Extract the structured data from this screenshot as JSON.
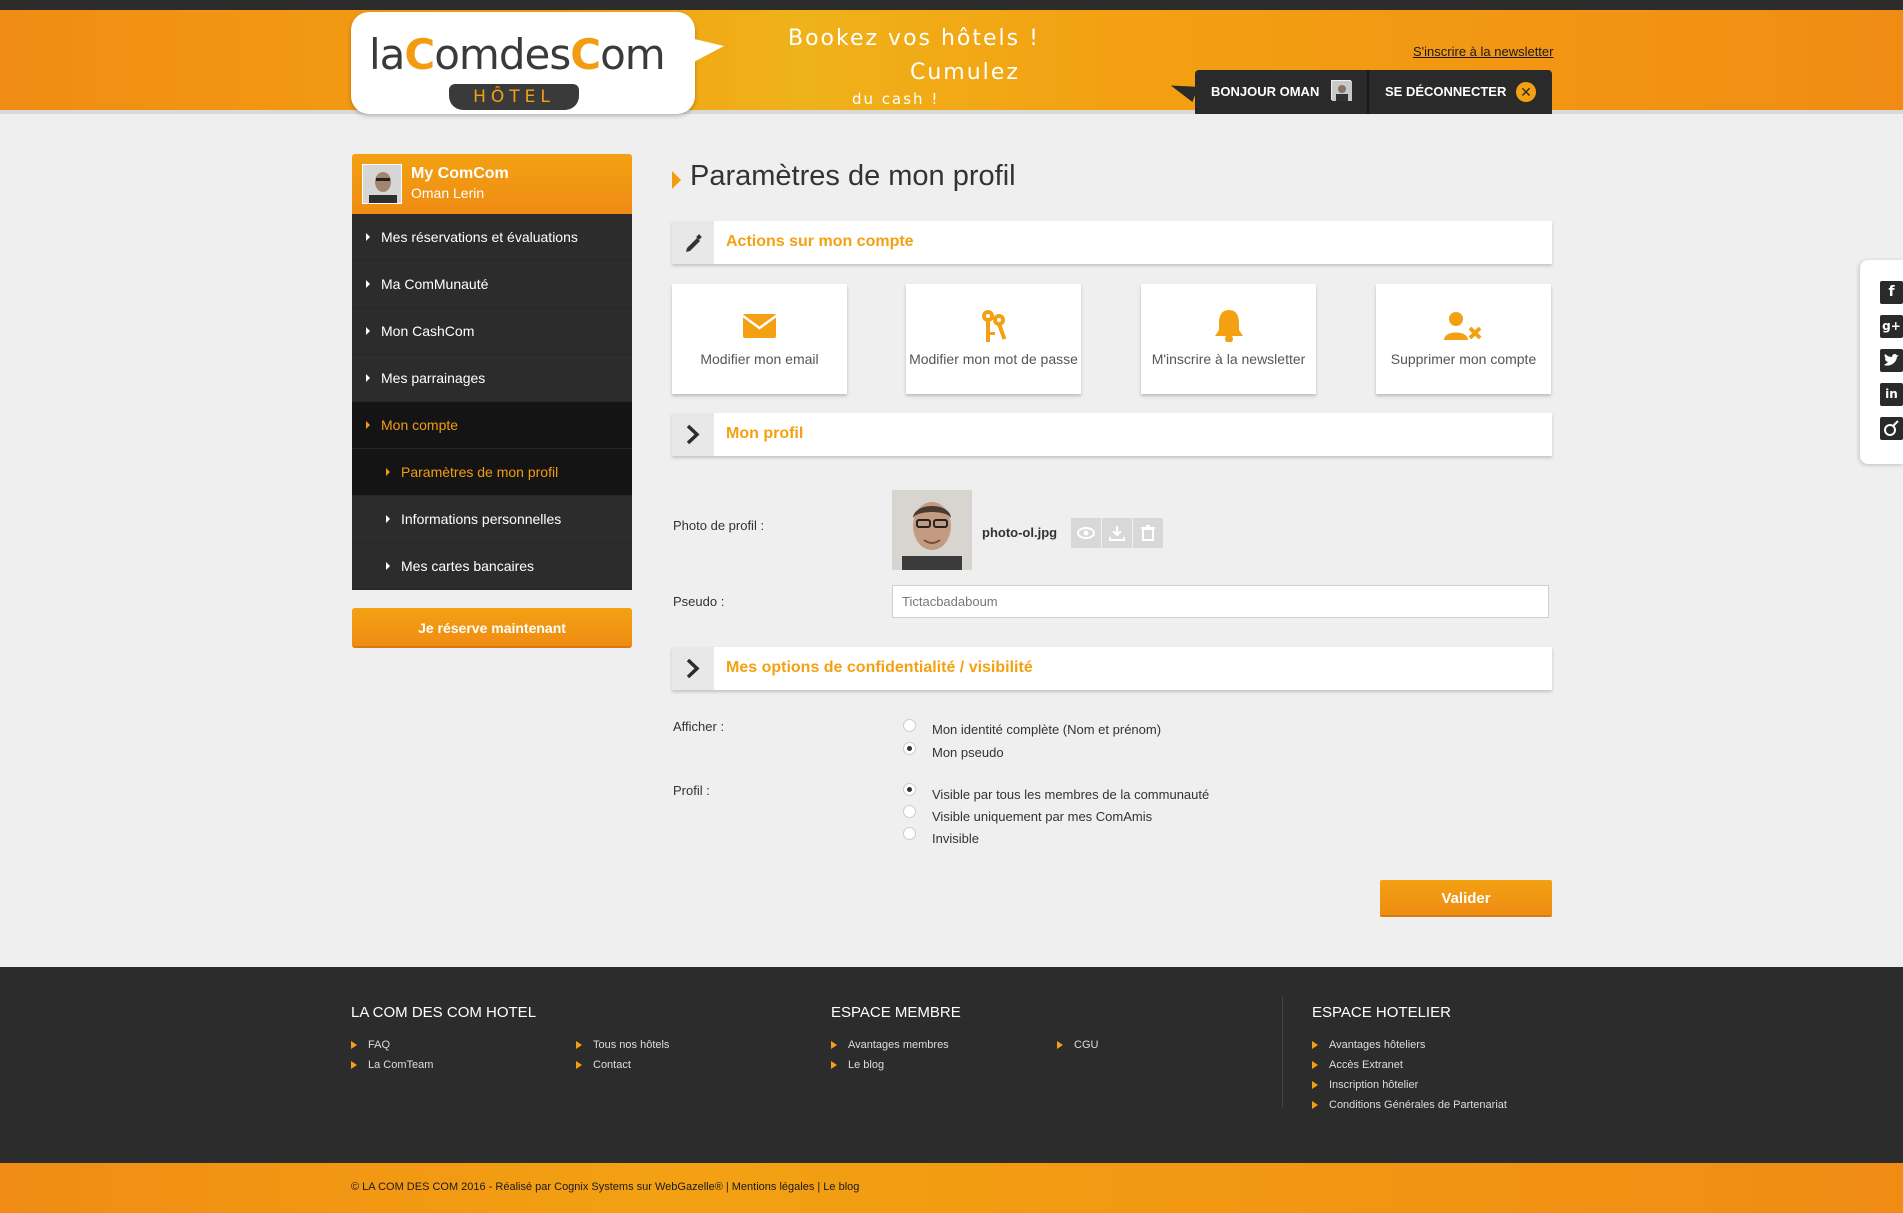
{
  "header": {
    "logo_text_1": "la",
    "logo_text_2": "C",
    "logo_text_3": "omdes",
    "logo_text_4": "C",
    "logo_text_5": "om",
    "logo_sub": "HÔTEL",
    "slogan_l1": "Bookez vos hôtels !",
    "slogan_l2": "Cumulez",
    "slogan_l3": "du cash !",
    "newsletter_link": "S'inscrire à la newsletter",
    "greeting": "BONJOUR OMAN",
    "logout": "SE DÉCONNECTER"
  },
  "sidebar": {
    "title": "My ComCom",
    "user_name": "Oman Lerin",
    "items": [
      {
        "label": "Mes réservations et évaluations"
      },
      {
        "label": "Ma ComMunauté"
      },
      {
        "label": "Mon CashCom"
      },
      {
        "label": "Mes parrainages"
      },
      {
        "label": "Mon compte"
      },
      {
        "label": "Paramètres de mon profil"
      },
      {
        "label": "Informations personnelles"
      },
      {
        "label": "Mes cartes bancaires"
      }
    ],
    "reserve_button": "Je réserve maintenant"
  },
  "main": {
    "page_title": "Paramètres de mon profil",
    "section_actions": "Actions sur mon compte",
    "actions": [
      {
        "label": "Modifier mon email",
        "icon": "envelope-icon"
      },
      {
        "label": "Modifier mon mot de passe",
        "icon": "keys-icon"
      },
      {
        "label": "M'inscrire à la newsletter",
        "icon": "bell-icon"
      },
      {
        "label": "Supprimer mon compte",
        "icon": "user-delete-icon"
      }
    ],
    "section_profile": "Mon profil",
    "photo_label": "Photo de profil :",
    "photo_filename": "photo-ol.jpg",
    "pseudo_label": "Pseudo :",
    "pseudo_value": "Tictacbadaboum",
    "section_privacy": "Mes options de confidentialité / visibilité",
    "afficher_label": "Afficher :",
    "afficher_options": [
      {
        "label": "Mon identité complète (Nom et prénom)",
        "selected": false
      },
      {
        "label": "Mon pseudo",
        "selected": true
      }
    ],
    "profil_label": "Profil :",
    "profil_options": [
      {
        "label": "Visible par tous les membres de la communauté",
        "selected": true
      },
      {
        "label": "Visible uniquement par mes ComAmis",
        "selected": false
      },
      {
        "label": "Invisible",
        "selected": false
      }
    ],
    "submit": "Valider"
  },
  "footer": {
    "col1_title": "LA COM DES COM HOTEL",
    "col1_links": [
      "FAQ",
      "La ComTeam",
      "Tous nos hôtels",
      "Contact"
    ],
    "col2_title": "ESPACE MEMBRE",
    "col2_links": [
      "Avantages membres",
      "Le blog",
      "CGU"
    ],
    "col3_title": "ESPACE HOTELIER",
    "col3_links": [
      "Avantages hôteliers",
      "Accès Extranet",
      "Inscription hôtelier",
      "Conditions Générales de Partenariat"
    ],
    "copyright": "© LA COM DES COM 2016 - Réalisé par Cognix Systems sur WebGazelle® | Mentions légales | Le blog"
  },
  "colors": {
    "accent": "#f3a112",
    "dark": "#2c2c2c"
  }
}
